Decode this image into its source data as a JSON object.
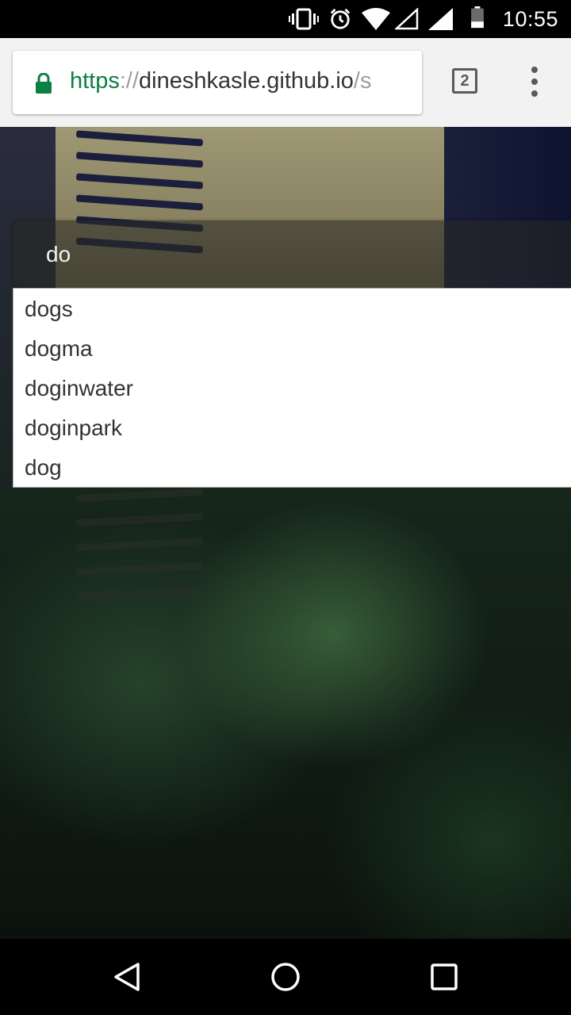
{
  "status_bar": {
    "time": "10:55",
    "icons": [
      "vibrate-icon",
      "alarm-icon",
      "wifi-icon",
      "signal-empty-icon",
      "signal-icon",
      "battery-icon"
    ]
  },
  "browser": {
    "url_scheme": "https",
    "url_separator": "://",
    "url_host": "dineshkasle.github.io",
    "url_path": "/s",
    "tab_count": "2",
    "icons": [
      "lock-icon",
      "menu-icon"
    ]
  },
  "page": {
    "search": {
      "value": "do"
    },
    "suggestions": [
      "dogs",
      "dogma",
      "doginwater",
      "doginpark",
      "dog"
    ]
  },
  "nav_bar": {
    "icons": [
      "back-icon",
      "home-icon",
      "recents-icon"
    ]
  },
  "colors": {
    "secure_green": "#0b8043",
    "toolbar_bg": "#f2f2f2",
    "icon_gray": "#5a5a5a"
  }
}
